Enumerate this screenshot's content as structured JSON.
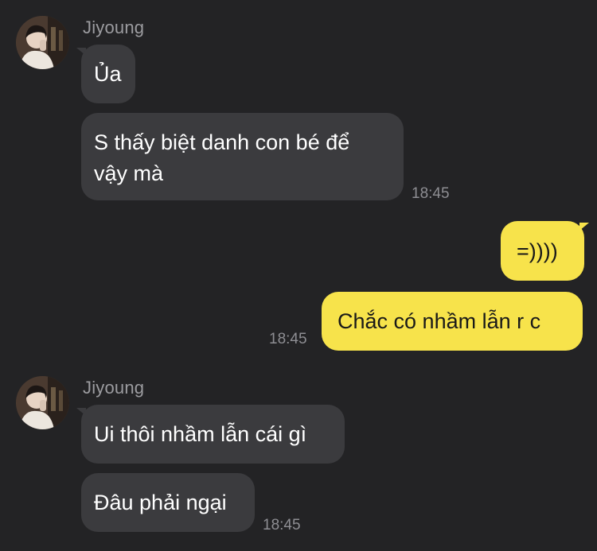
{
  "group1": {
    "sender": "Jiyoung",
    "avatar": "profile-photo",
    "messages": [
      "Ủa",
      "S thấy biệt danh con bé để vậy mà"
    ],
    "time": "18:45"
  },
  "mine": {
    "messages": [
      "=))))",
      "Chắc có nhầm lẫn r c"
    ],
    "time": "18:45",
    "bubble_color": "#f7e34b"
  },
  "group2": {
    "sender": "Jiyoung",
    "avatar": "profile-photo",
    "messages": [
      "Ui thôi nhầm lẫn cái gì",
      "Đâu phải ngại"
    ],
    "time": "18:45"
  },
  "colors": {
    "background": "#232325",
    "incoming_bubble": "#3b3b3e",
    "outgoing_bubble": "#f7e34b",
    "sender_name": "#9c9ca0",
    "timestamp": "#8e8e93"
  }
}
